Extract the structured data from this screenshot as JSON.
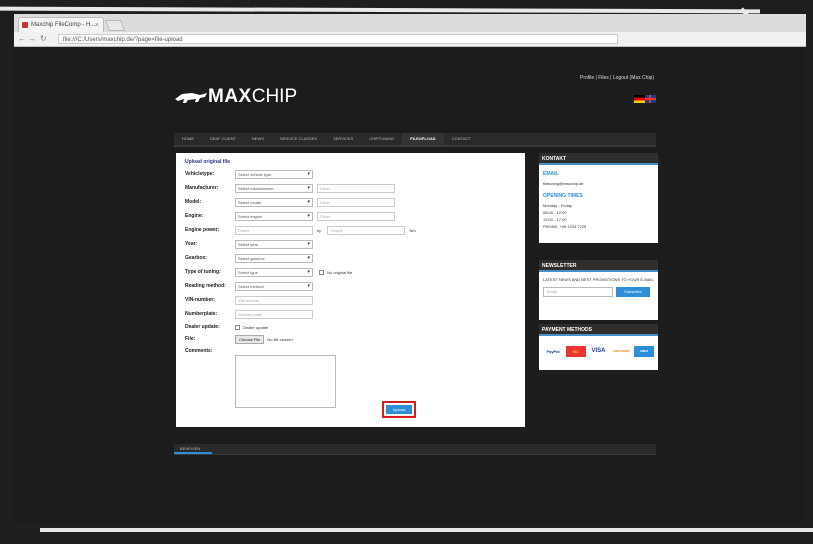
{
  "browser": {
    "tab_title": "Maxchip FileComp - H...",
    "url": "file:///C:/Users/maxchip.de/?page=file-upload"
  },
  "header": {
    "top_links": "Profile | Files | Logout (Max Chip)",
    "logo_bold": "MAX",
    "logo_light": "CHIP"
  },
  "nav": {
    "items": [
      "HOME",
      "DEAF CLIENT",
      "NEWS",
      "SERVICE CLASSES",
      "SERVICES",
      "CHIPTUNING",
      "FILEUPLOAD",
      "CONTACT"
    ]
  },
  "form": {
    "title": "Upload original file",
    "vehicletype_label": "Vehicletype:",
    "vehicletype_value": "Select vehicle type",
    "manufacturer_label": "Manufacturer:",
    "manufacturer_value": "Select manufacturer",
    "manufacturer_other": "Other",
    "model_label": "Model:",
    "model_value": "Select model",
    "model_other": "Other",
    "engine_label": "Engine:",
    "engine_value": "Select engine",
    "engine_other": "Other",
    "power_label": "Engine power:",
    "power_placeholder": "Power",
    "power_unit": "hp",
    "torque_placeholder": "Torque",
    "torque_unit": "Nm",
    "year_label": "Year:",
    "year_value": "Select year",
    "gearbox_label": "Gearbox:",
    "gearbox_value": "Select gearbox",
    "tuning_label": "Type of tuning:",
    "tuning_value": "Select type",
    "original_file_label": "No original file",
    "reading_label": "Reading method:",
    "reading_value": "Select method",
    "vin_label": "VIN-number:",
    "vin_placeholder": "VIN number",
    "plate_label": "Numberplate:",
    "plate_placeholder": "Number plate",
    "dealer_label": "Dealer update:",
    "dealer_option": "Dealer update",
    "file_label": "File:",
    "file_button": "Choose File",
    "file_status": "No file chosen",
    "comments_label": "Comments:",
    "upload_label": "Upload"
  },
  "sidebar": {
    "kontakt_head": "KONTAKT",
    "email_head": "EMAIL",
    "email": "filetuning@maxchip.de",
    "hours_head": "OPENING TIMES",
    "hours_1": "Monday - Friday",
    "hours_2": "08:00 - 12:00",
    "hours_3": "13:00 - 17:00",
    "phone": "PHONE: +49 1234 7229",
    "newsletter_head": "NEWSLETTER",
    "newsletter_text": "LATEST NEWS AND BEST PROMOTIONS TO YOUR E-MAIL",
    "newsletter_placeholder": "Email",
    "newsletter_button": "Subscribe",
    "payment_head": "PAYMENT METHODS",
    "payments": [
      "PayPal",
      "MC",
      "VISA",
      "DISCOVER",
      "AMEX"
    ]
  },
  "footer": {
    "tab": "BEHEIVEN"
  },
  "colors": {
    "accent": "#2d8fd5",
    "highlight": "#d41d1d"
  }
}
